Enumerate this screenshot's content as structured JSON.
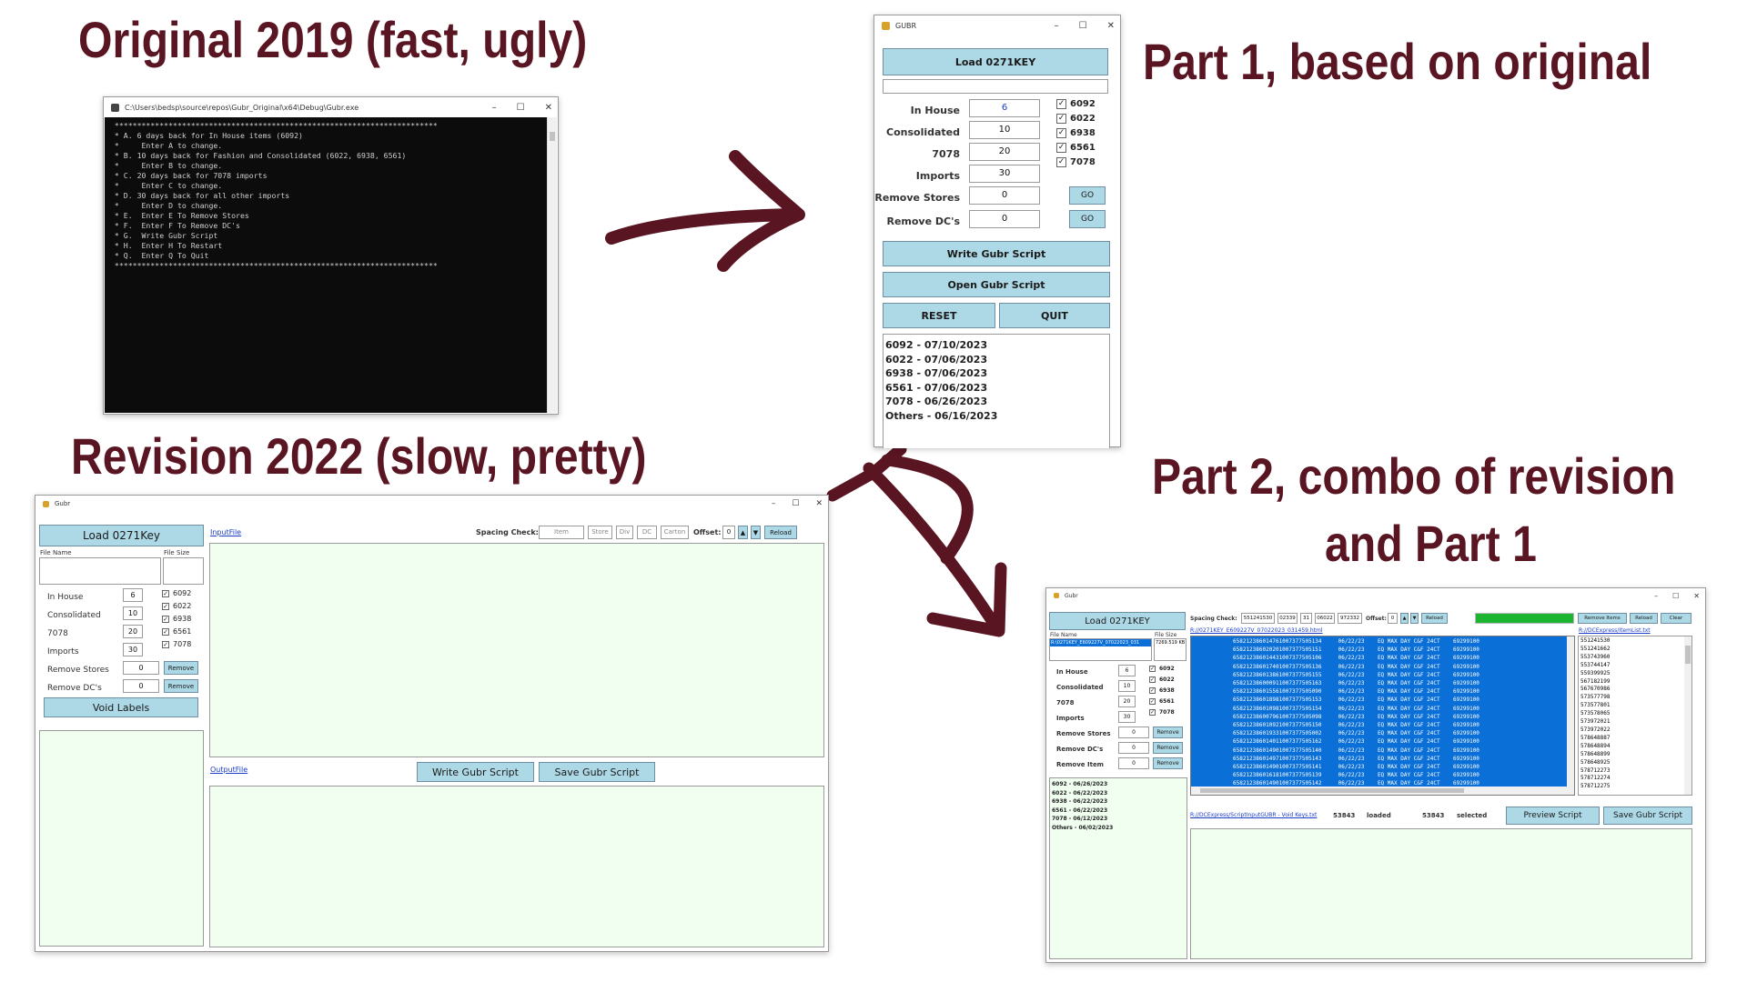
{
  "headings": {
    "original": "Original 2019 (fast, ugly)",
    "part1": "Part 1, based on original",
    "revision": "Revision 2022 (slow, pretty)",
    "part2_line1": "Part 2, combo of revision",
    "part2_line2": "and Part 1"
  },
  "console": {
    "title": "C:\\Users\\bedsp\\source\\repos\\Gubr_Original\\x64\\Debug\\Gubr.exe",
    "lines": [
      " ************************************************************************",
      " * A. 6 days back for In House items (6092)",
      " *     Enter A to change.",
      " * B. 10 days back for Fashion and Consolidated (6022, 6938, 6561)",
      " *     Enter B to change.",
      " * C. 20 days back for 7078 imports",
      " *     Enter C to change.",
      " * D. 30 days back for all other imports",
      " *     Enter D to change.",
      " * E.  Enter E To Remove Stores",
      " * F.  Enter F To Remove DC's",
      " * G.  Write Gubr Script",
      " * H.  Enter H To Restart",
      " * Q.  Enter Q To Quit",
      " ************************************************************************"
    ]
  },
  "part1": {
    "title": "GUBR",
    "load_button": "Load 0271KEY",
    "labels": {
      "in_house": "In House",
      "consolidated": "Consolidated",
      "n7078": "7078",
      "imports": "Imports",
      "remove_stores": "Remove Stores",
      "remove_dcs": "Remove DC's"
    },
    "values": {
      "in_house": "6",
      "consolidated": "10",
      "n7078": "20",
      "imports": "30",
      "remove_stores": "0",
      "remove_dcs": "0"
    },
    "checkboxes": [
      "6092",
      "6022",
      "6938",
      "6561",
      "7078"
    ],
    "go_label": "GO",
    "write_button": "Write Gubr Script",
    "open_button": "Open Gubr Script",
    "reset_button": "RESET",
    "quit_button": "QUIT",
    "dates": [
      "6092 - 07/10/2023",
      "6022 - 07/06/2023",
      "6938 - 07/06/2023",
      "6561 - 07/06/2023",
      "7078 - 06/26/2023",
      "Others - 06/16/2023"
    ]
  },
  "revision": {
    "title": "Gubr",
    "load_button": "Load 0271Key",
    "file_name_label": "File Name",
    "file_size_label": "File Size",
    "labels": {
      "in_house": "In House",
      "consolidated": "Consolidated",
      "n7078": "7078",
      "imports": "Imports",
      "remove_stores": "Remove Stores",
      "remove_dcs": "Remove DC's"
    },
    "values": {
      "in_house": "6",
      "consolidated": "10",
      "n7078": "20",
      "imports": "30",
      "remove_stores": "0",
      "remove_dcs": "0"
    },
    "checkboxes": [
      "6092",
      "6022",
      "6938",
      "6561",
      "7078"
    ],
    "remove_label": "Remove",
    "void_button": "Void Labels",
    "input_link": "InputFile",
    "output_link": "OutputFile",
    "spacing_label": "Spacing Check:",
    "spacing_fields": [
      "Item",
      "Store",
      "Div",
      "DC",
      "Carton"
    ],
    "offset_label": "Offset:",
    "offset_value": "0",
    "reload_label": "Reload",
    "write_button": "Write Gubr Script",
    "save_button": "Save Gubr Script"
  },
  "part2": {
    "title": "Gubr",
    "load_button": "Load 0271KEY",
    "file_name_label": "File Name",
    "file_size_label": "File Size",
    "file_entry": "R:\\0271KEY_E609227V_07022023_031",
    "file_size": "7269.519 KB",
    "labels": {
      "in_house": "In House",
      "consolidated": "Consolidated",
      "n7078": "7078",
      "imports": "Imports",
      "remove_stores": "Remove Stores",
      "remove_dcs": "Remove DC's",
      "remove_item": "Remove Item"
    },
    "values": {
      "in_house": "6",
      "consolidated": "10",
      "n7078": "20",
      "imports": "30",
      "remove_stores": "0",
      "remove_dcs": "0",
      "remove_item": "0"
    },
    "checkboxes": [
      "6092",
      "6022",
      "6938",
      "6561",
      "7078"
    ],
    "remove_label": "Remove",
    "dates": [
      "6092 - 06/26/2023",
      "6022 - 06/22/2023",
      "6938 - 06/22/2023",
      "6561 - 06/22/2023",
      "7078 - 06/12/2023",
      "Others - 06/02/2023"
    ],
    "spacing_label": "Spacing Check:",
    "spacing_fields": [
      "551241530",
      "02339",
      "31",
      "06022",
      "972332"
    ],
    "offset_label": "Offset:",
    "offset_value": "0",
    "reload_label": "Reload",
    "remove_items_label": "Remove Items",
    "reload2_label": "Reload",
    "clear_label": "Clear",
    "input_link": "R://0271KEY_E609227V_07022023_031459.html",
    "item_list_link": "R://DCExpress/ItemList.txt",
    "script_link": "R://DCExpress/ScriptInputGUBR - Void Keys.txt",
    "loaded_count": "53843",
    "loaded_label": "loaded",
    "selected_count": "53843",
    "selected_label": "selected",
    "preview_button": "Preview Script",
    "save_button": "Save Gubr Script",
    "rows": [
      "658212386014761007377505134     06/22/23    EQ MAX DAY C&F 24CT    69299100",
      "658212386020201007377505151     06/22/23    EQ MAX DAY C&F 24CT    69299100",
      "658212386014431007377505106     06/22/23    EQ MAX DAY C&F 24CT    69299100",
      "658212386017401007377505136     06/22/23    EQ MAX DAY C&F 24CT    69299100",
      "658212386013861007377505155     06/22/23    EQ MAX DAY C&F 24CT    69299100",
      "658212386000911007377505163     06/22/23    EQ MAX DAY C&F 24CT    69299100",
      "658212386015561007377505090     06/22/23    EQ MAX DAY C&F 24CT    69299100",
      "658212386018981007377505153     06/22/23    EQ MAX DAY C&F 24CT    69299100",
      "658212386010981007377505154     06/22/23    EQ MAX DAY C&F 24CT    69299100",
      "658212386007961007377505098     06/22/23    EQ MAX DAY C&F 24CT    69299100",
      "658212386010921007377505150     06/22/23    EQ MAX DAY C&F 24CT    69299100",
      "658212386019331007377505002     06/22/23    EQ MAX DAY C&F 24CT    69299100",
      "658212386014011007377505162     06/22/23    EQ MAX DAY C&F 24CT    69299100",
      "658212386014901007377505140     06/22/23    EQ MAX DAY C&F 24CT    69299100",
      "658212386014971007377505143     06/22/23    EQ MAX DAY C&F 24CT    69299100",
      "658212386014901007377505141     06/22/23    EQ MAX DAY C&F 24CT    69299100",
      "658212386016181007377505139     06/22/23    EQ MAX DAY C&F 24CT    69299100",
      "658212386014901007377505142     06/22/23    EQ MAX DAY C&F 24CT    69299100"
    ],
    "item_list": [
      "551241530",
      "551241662",
      "553743960",
      "553744147",
      "559399925",
      "567182199",
      "567670986",
      "573577798",
      "573577801",
      "573578065",
      "573972021",
      "573972022",
      "578648887",
      "578648894",
      "578648899",
      "578648925",
      "578712273",
      "578712274",
      "578712275"
    ]
  },
  "colors": {
    "heading": "#5a1522",
    "arrow": "#5a1522",
    "button": "#add8e6",
    "selection": "#0a6fd6",
    "progress": "#1cb531",
    "panel": "#f0fff0"
  }
}
